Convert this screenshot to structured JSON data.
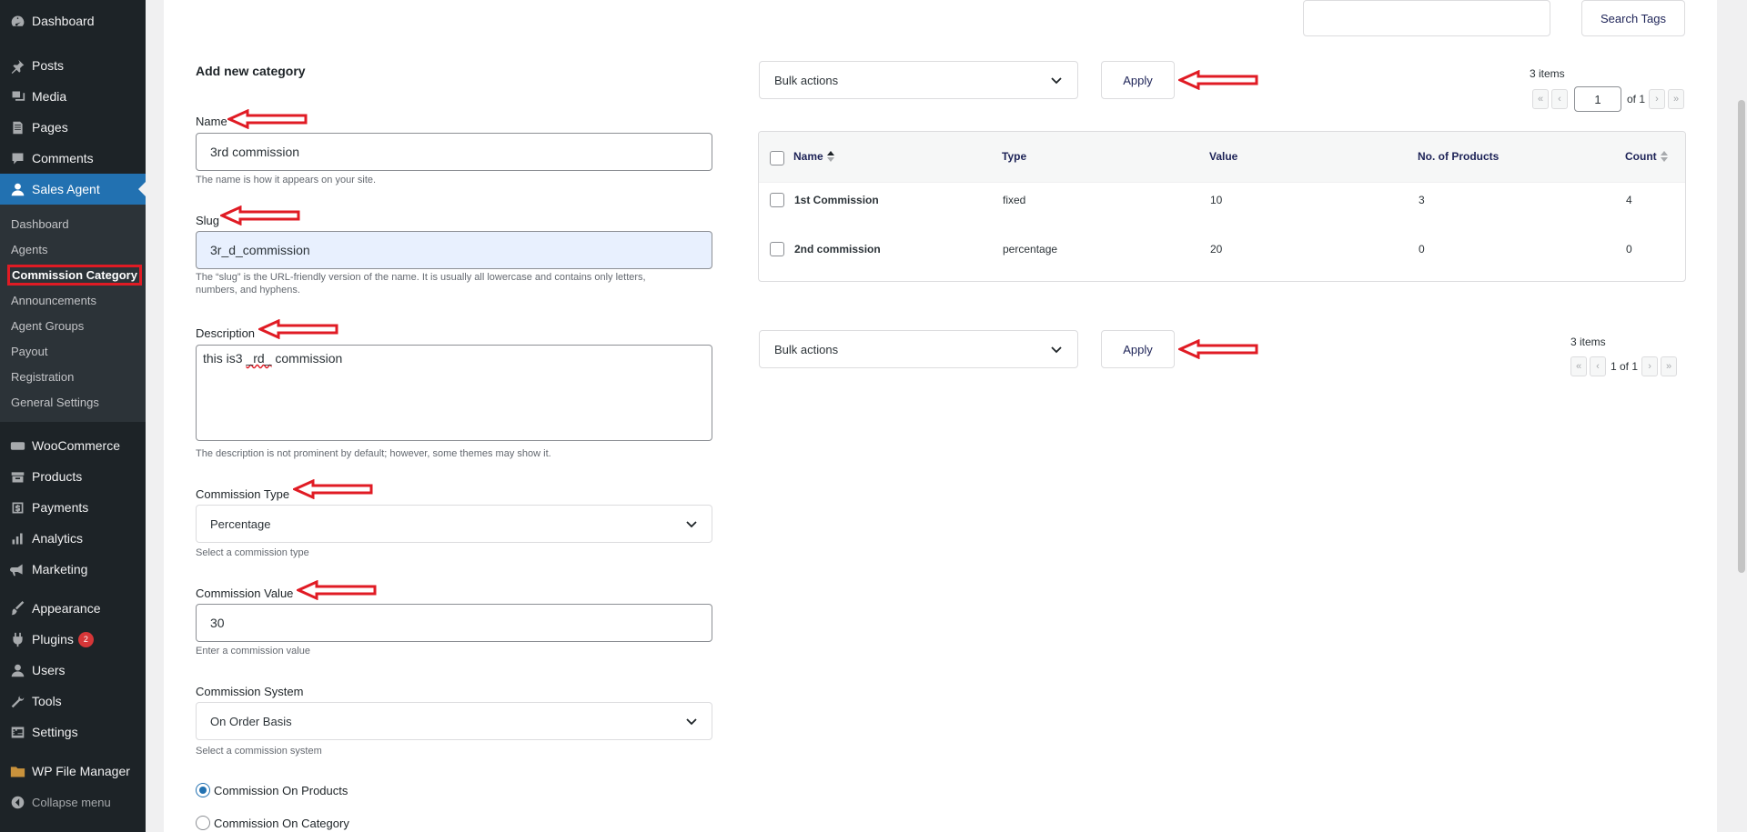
{
  "sidebar": {
    "top_items": [
      {
        "label": "Dashboard",
        "icon": "dashboard-icon"
      },
      {
        "label": "Posts",
        "icon": "pin-icon"
      },
      {
        "label": "Media",
        "icon": "media-icon"
      },
      {
        "label": "Pages",
        "icon": "pages-icon"
      },
      {
        "label": "Comments",
        "icon": "comment-icon"
      },
      {
        "label": "Sales Agent",
        "icon": "user-icon"
      }
    ],
    "submenu": [
      "Dashboard",
      "Agents",
      "Commission Category",
      "Announcements",
      "Agent Groups",
      "Payout",
      "Registration",
      "General Settings"
    ],
    "lower_items": [
      {
        "label": "WooCommerce",
        "icon": "woo-icon"
      },
      {
        "label": "Products",
        "icon": "archive-icon"
      },
      {
        "label": "Payments",
        "icon": "dollar-icon"
      },
      {
        "label": "Analytics",
        "icon": "bar-chart-icon"
      },
      {
        "label": "Marketing",
        "icon": "megaphone-icon"
      }
    ],
    "tools_items": [
      {
        "label": "Appearance",
        "icon": "brush-icon"
      },
      {
        "label": "Plugins",
        "icon": "plug-icon",
        "badge": "2"
      },
      {
        "label": "Users",
        "icon": "users-icon"
      },
      {
        "label": "Tools",
        "icon": "wrench-icon"
      },
      {
        "label": "Settings",
        "icon": "settings-icon"
      }
    ],
    "file_manager": "WP File Manager",
    "collapse": "Collapse menu"
  },
  "search": {
    "button": "Search Tags",
    "value": ""
  },
  "form": {
    "heading": "Add new category",
    "name_label": "Name",
    "name_value": "3rd commission",
    "name_help": "The name is how it appears on your site.",
    "slug_label": "Slug",
    "slug_value": "3r_d_commission",
    "slug_help": "The “slug” is the URL-friendly version of the name. It is usually all lowercase and contains only letters, numbers, and hyphens.",
    "desc_label": "Description",
    "desc_value_a": "this is3 ",
    "desc_value_b": "_rd_",
    "desc_value_c": " commission",
    "desc_help": "The description is not prominent by default; however, some themes may show it.",
    "type_label": "Commission Type",
    "type_value": "Percentage",
    "type_help": "Select a commission type",
    "value_label": "Commission Value",
    "value_value": "30",
    "value_help": "Enter a commission value",
    "system_label": "Commission System",
    "system_value": "On Order Basis",
    "system_help": "Select a commission system",
    "radio_products": "Commission On Products",
    "radio_category": "Commission On Category"
  },
  "table": {
    "bulk_label": "Bulk actions",
    "apply_label": "Apply",
    "items_count": "3 items",
    "page_current": "1",
    "page_of": "of 1",
    "page_summary": "1 of 1",
    "columns": [
      "Name",
      "Type",
      "Value",
      "No. of Products",
      "Count"
    ],
    "rows": [
      [
        "1st Commission",
        "fixed",
        "10",
        "3",
        "4"
      ],
      [
        "2nd commission",
        "percentage",
        "20",
        "0",
        "0"
      ]
    ]
  },
  "colors": {
    "accent": "#2271b1",
    "annotation": "#e01b24",
    "sidebar_bg": "#1d2327"
  }
}
